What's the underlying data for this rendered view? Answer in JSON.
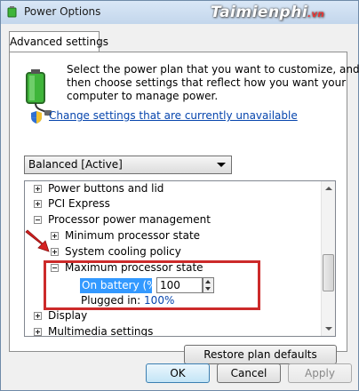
{
  "window": {
    "title": "Power Options",
    "watermark": "Taimienphi",
    "watermark_suffix": ".vn"
  },
  "tab": {
    "label": "Advanced settings"
  },
  "intro": {
    "lines": [
      "Select the power plan that you want to customize, and",
      "then choose settings that reflect how you want your",
      "computer to manage power."
    ],
    "link": "Change settings that are currently unavailable"
  },
  "plan": {
    "selected": "Balanced [Active]"
  },
  "tree": {
    "items": [
      {
        "label": "Power buttons and lid",
        "expander": "plus"
      },
      {
        "label": "PCI Express",
        "expander": "plus"
      },
      {
        "label": "Processor power management",
        "expander": "minus"
      },
      {
        "label": "Minimum processor state",
        "expander": "plus"
      },
      {
        "label": "System cooling policy",
        "expander": "plus"
      },
      {
        "label": "Maximum processor state",
        "expander": "minus"
      },
      {
        "label": "Display",
        "expander": "plus"
      },
      {
        "label": "Multimedia settings",
        "expander": "plus"
      }
    ],
    "on_battery": {
      "label": "On battery (%):",
      "value": "100"
    },
    "plugged_in": {
      "label": "Plugged in:",
      "value": "100%"
    }
  },
  "buttons": {
    "restore": "Restore plan defaults",
    "ok": "OK",
    "cancel": "Cancel",
    "apply": "Apply"
  },
  "colors": {
    "selection": "#3399ff",
    "highlight_box": "#cc2a2a",
    "link": "#0645ad",
    "battery_green": "#3fb53a"
  },
  "icons": {
    "title": "power-options-icon",
    "battery": "battery-plug-icon",
    "shield": "uac-shield-icon",
    "arrow": "red-arrow-icon"
  }
}
